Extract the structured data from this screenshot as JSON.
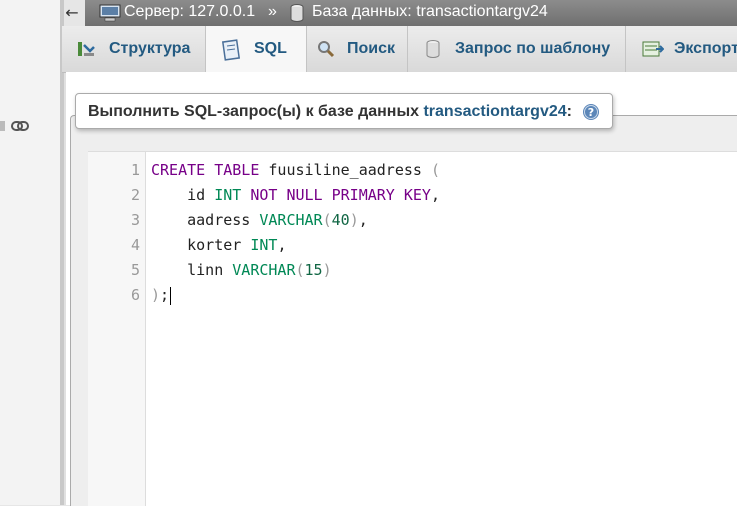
{
  "breadcrumb": {
    "back_arrow": "←",
    "server": "Сервер: 127.0.0.1",
    "separator": "»",
    "database": "База данных: transactiontargv24"
  },
  "tabs": [
    {
      "label": "Структура",
      "icon": "structure-icon"
    },
    {
      "label": "SQL",
      "icon": "sql-icon",
      "active": true
    },
    {
      "label": "Поиск",
      "icon": "search-icon"
    },
    {
      "label": "Запрос по шаблону",
      "icon": "query-icon"
    },
    {
      "label": "Экспорт",
      "icon": "export-icon"
    }
  ],
  "panel": {
    "title_prefix": "Выполнить SQL-запрос(ы) к базе данных ",
    "db_name": "transactiontargv24",
    "title_suffix": ":"
  },
  "editor": {
    "line_numbers": [
      "1",
      "2",
      "3",
      "4",
      "5",
      "6"
    ],
    "lines": [
      "CREATE TABLE fuusiline_aadress (",
      "    id INT NOT NULL PRIMARY KEY,",
      "    aadress VARCHAR(40),",
      "    korter INT,",
      "    linn VARCHAR(15)",
      ");"
    ]
  },
  "colors": {
    "keyword": "#770088",
    "type": "#008855",
    "link": "#235a81"
  }
}
